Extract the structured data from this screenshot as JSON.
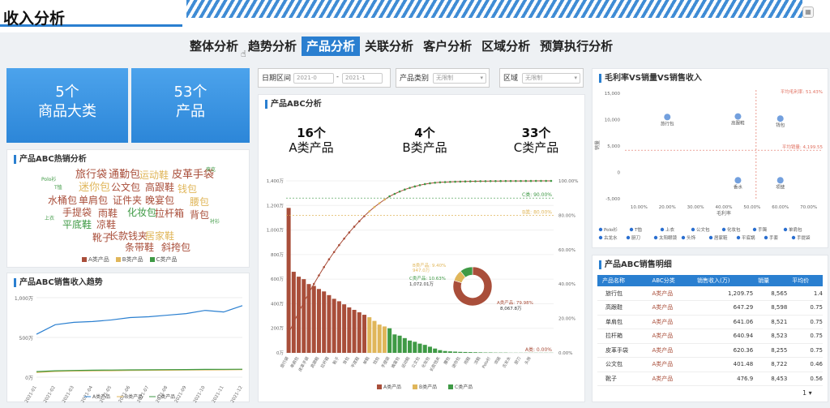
{
  "page": {
    "title": "收入分析",
    "corner_icon": "grid-icon"
  },
  "nav": {
    "tabs": [
      "整体分析",
      "趋势分析",
      "产品分析",
      "关联分析",
      "客户分析",
      "区域分析",
      "预算执行分析"
    ],
    "active": 2
  },
  "kpis": [
    {
      "value": "5个",
      "label": "商品大类"
    },
    {
      "value": "53个",
      "label": "产品"
    }
  ],
  "filters": {
    "date_label": "日期区间",
    "date_start": "2021-0",
    "date_sep": "-",
    "date_end": "2021-1",
    "category_label": "产品类别",
    "category_value": "无限制",
    "region_label": "区域",
    "region_value": "无限制"
  },
  "wordcloud": {
    "title": "产品ABC热销分析",
    "words": [
      "旅行袋",
      "通勤包",
      "运动鞋",
      "皮革手袋",
      "迷你包",
      "公文包",
      "高跟鞋",
      "钱包",
      "水桶包",
      "单肩包",
      "证件夹",
      "晚宴包",
      "腰包",
      "手提袋",
      "雨鞋",
      "化妆包",
      "拉杆箱",
      "背包",
      "平底鞋",
      "凉鞋",
      "靴子",
      "长款钱夹",
      "居家鞋",
      "条带鞋",
      "斜挎包",
      "Polo衫",
      "T恤",
      "上衣",
      "夹克",
      "衬衫"
    ],
    "legend": [
      "A类产品",
      "B类产品",
      "C类产品"
    ]
  },
  "trend": {
    "title": "产品ABC销售收入趋势",
    "y_ticks": [
      "1,000万",
      "500万",
      "0万"
    ],
    "legend": [
      "A类产品",
      "B类产品",
      "C类产品"
    ]
  },
  "abc": {
    "title": "产品ABC分析",
    "a_count": "16个",
    "a_label": "A类产品",
    "b_count": "4个",
    "b_label": "B类产品",
    "c_count": "33个",
    "c_label": "C类产品",
    "legend": [
      "A类产品",
      "B类产品",
      "C类产品"
    ],
    "markers": [
      "C类: 90.00%",
      "B类: 80.00%",
      "A类: 0.00%"
    ],
    "donut_labels": [
      "B类产品: 9.40%",
      "947.0万",
      "C类产品: 10.63%",
      "1,072.01万",
      "A类产品: 79.98%",
      "8,067.8万"
    ]
  },
  "scatter": {
    "title": "毛利率VS销量VS销售收入",
    "avg_margin": "平均毛利率: 51.43%",
    "avg_sales": "平均销量: 4,199.55",
    "x_label": "毛利率",
    "y_label": "销量",
    "x_ticks": [
      "10.00%",
      "20.00%",
      "30.00%",
      "40.00%",
      "50.00%",
      "60.00%",
      "70.00%"
    ],
    "y_ticks": [
      "15,000",
      "10,000",
      "5,000",
      "0",
      "-5,000"
    ],
    "point_labels": [
      "旅行包",
      "高跟鞋",
      "钱包",
      "香水",
      "项链"
    ],
    "legend": [
      "Polo衫",
      "T恤",
      "上衣",
      "公文包",
      "化妆包",
      "手镯",
      "单肩包",
      "古龙水",
      "厨刀",
      "太阳眼镜",
      "头饰",
      "居家鞋",
      "平底锅",
      "手套",
      "手提袋"
    ]
  },
  "detail": {
    "title": "产品ABC销售明细",
    "columns": [
      "产品名称",
      "ABC分类",
      "销售收入(万)",
      "销量",
      "平均价"
    ],
    "rows": [
      {
        "name": "旅行包",
        "cls": "A类产品",
        "rev": "1,209.75",
        "qty": "8,565",
        "avg": "1.4"
      },
      {
        "name": "高跟鞋",
        "cls": "A类产品",
        "rev": "647.29",
        "qty": "8,598",
        "avg": "0.75"
      },
      {
        "name": "单肩包",
        "cls": "A类产品",
        "rev": "641.06",
        "qty": "8,521",
        "avg": "0.75"
      },
      {
        "name": "拉杆箱",
        "cls": "A类产品",
        "rev": "640.94",
        "qty": "8,523",
        "avg": "0.75"
      },
      {
        "name": "皮革手袋",
        "cls": "A类产品",
        "rev": "620.36",
        "qty": "8,255",
        "avg": "0.75"
      },
      {
        "name": "公文包",
        "cls": "A类产品",
        "rev": "401.48",
        "qty": "8,722",
        "avg": "0.46"
      },
      {
        "name": "靴子",
        "cls": "A类产品",
        "rev": "476.9",
        "qty": "8,453",
        "avg": "0.56"
      }
    ],
    "page": "1"
  },
  "colors": {
    "accent": "#2a7fd0",
    "a": "#a94e3a",
    "b": "#e0b65a",
    "c": "#3f9a45"
  },
  "chart_data": [
    {
      "type": "bar",
      "title": "产品ABC分析",
      "ylim": [
        0,
        1400
      ],
      "y2lim": [
        0,
        100
      ],
      "values": [
        1180,
        660,
        620,
        600,
        560,
        545,
        520,
        500,
        470,
        440,
        420,
        395,
        370,
        350,
        330,
        310,
        290,
        260,
        230,
        215,
        200,
        150,
        140,
        120,
        100,
        90,
        75,
        65,
        50,
        35,
        22,
        15,
        12,
        10,
        8,
        7,
        6,
        5,
        4,
        3,
        3,
        2,
        2,
        2,
        1,
        1,
        1,
        1,
        1,
        1,
        1,
        1,
        1
      ],
      "classes": [
        "A",
        "A",
        "A",
        "A",
        "A",
        "A",
        "A",
        "A",
        "A",
        "A",
        "A",
        "A",
        "A",
        "A",
        "A",
        "A",
        "B",
        "B",
        "B",
        "B",
        "C",
        "C",
        "C",
        "C",
        "C",
        "C",
        "C",
        "C",
        "C",
        "C",
        "C",
        "C",
        "C",
        "C",
        "C",
        "C",
        "C",
        "C",
        "C",
        "C",
        "C",
        "C",
        "C",
        "C",
        "C",
        "C",
        "C",
        "C",
        "C",
        "C",
        "C",
        "C",
        "C"
      ],
      "categories": [
        "旅行袋",
        "单肩包",
        "皮革手袋",
        "高跟鞋",
        "拉杆箱",
        "靴子",
        "背包",
        "平底鞋",
        "单鞋",
        "钱包",
        "手提袋",
        "晚宴包",
        "运动鞋",
        "公文包",
        "化妆包",
        "长款钱夹",
        "腰包",
        "迷你包",
        "雨鞋",
        "凉鞋",
        "Polo衫",
        "项链",
        "古龙水",
        "厨刀",
        "头饰"
      ],
      "y_ticks": [
        "1,400万",
        "1,200万",
        "1,000万",
        "800万",
        "600万",
        "400万",
        "200万",
        "0万"
      ],
      "y2_ticks": [
        "100.00%",
        "80.00%",
        "60.00%",
        "40.00%",
        "20.00%",
        "0.00%"
      ]
    },
    {
      "type": "line",
      "title": "产品ABC销售收入趋势",
      "x": [
        "2021-01",
        "2021-02",
        "2021-03",
        "2021-04",
        "2021-05",
        "2021-06",
        "2021-07",
        "2021-08",
        "2021-09",
        "2021-10",
        "2021-11",
        "2021-12"
      ],
      "series": [
        {
          "name": "A类产品",
          "values": [
            540,
            660,
            690,
            700,
            720,
            750,
            760,
            780,
            800,
            840,
            820,
            900
          ]
        },
        {
          "name": "B类产品",
          "values": [
            60,
            72,
            78,
            80,
            82,
            85,
            86,
            88,
            90,
            92,
            93,
            95
          ]
        },
        {
          "name": "C类产品",
          "values": [
            70,
            80,
            85,
            88,
            90,
            92,
            93,
            95,
            96,
            98,
            99,
            100
          ]
        }
      ],
      "ylim": [
        0,
        1000
      ]
    },
    {
      "type": "pie",
      "title": "ABC占比",
      "labels": [
        "A类产品",
        "B类产品",
        "C类产品"
      ],
      "values": [
        79.98,
        9.4,
        10.63
      ]
    }
  ]
}
